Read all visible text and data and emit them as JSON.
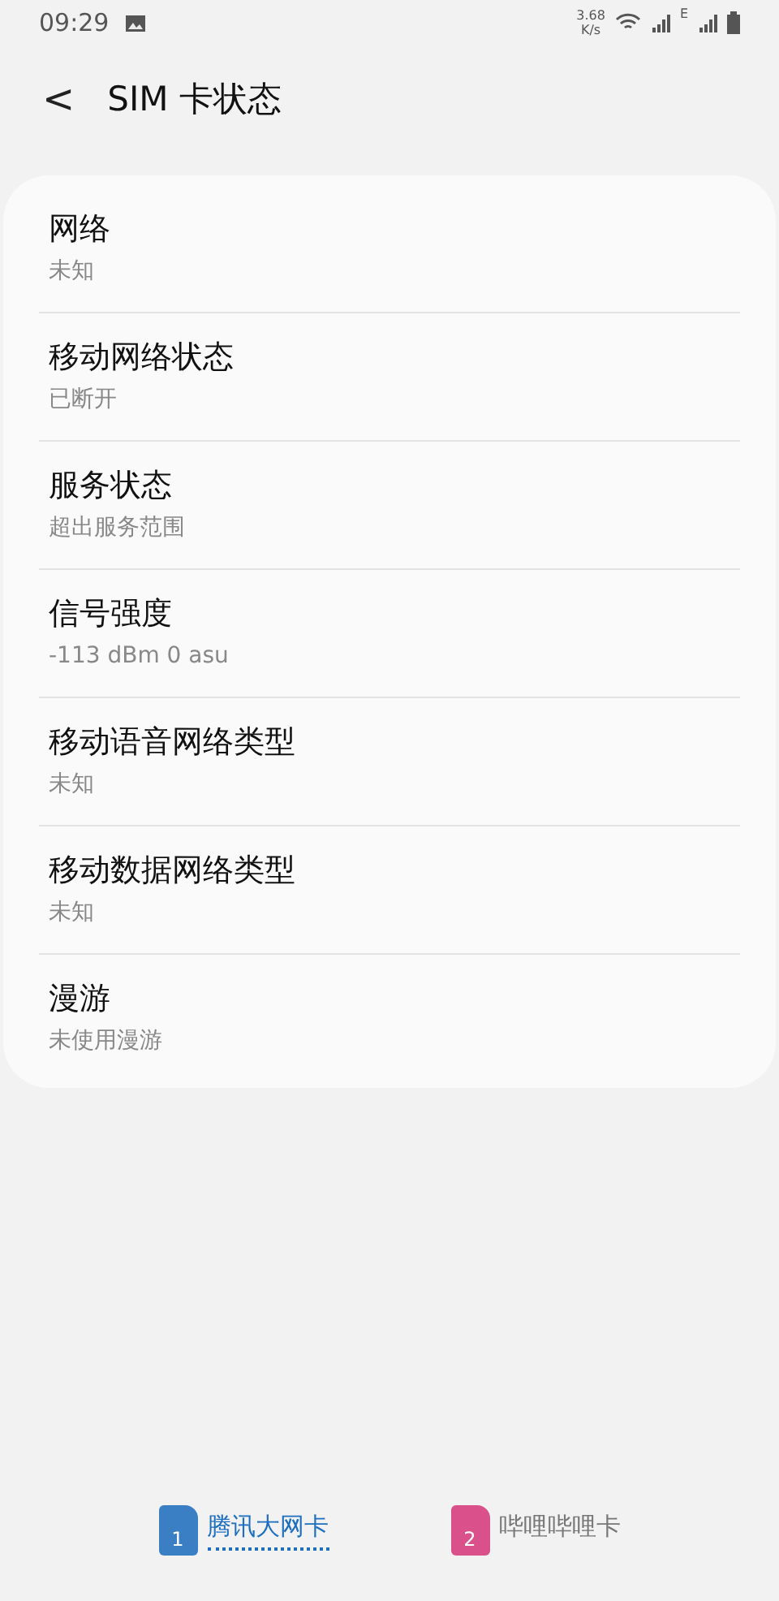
{
  "status_bar": {
    "time": "09:29",
    "speed_value": "3.68",
    "speed_unit": "K/s",
    "sim2_network": "E"
  },
  "header": {
    "back": "<",
    "title": "SIM 卡状态"
  },
  "items": [
    {
      "title": "网络",
      "value": "未知"
    },
    {
      "title": "移动网络状态",
      "value": "已断开"
    },
    {
      "title": "服务状态",
      "value": "超出服务范围"
    },
    {
      "title": "信号强度",
      "value": "-113 dBm 0 asu"
    },
    {
      "title": "移动语音网络类型",
      "value": "未知"
    },
    {
      "title": "移动数据网络类型",
      "value": "未知"
    },
    {
      "title": "漫游",
      "value": "未使用漫游"
    }
  ],
  "sim_tabs": [
    {
      "number": "1",
      "label": "腾讯大网卡",
      "selected": true,
      "color": "#3a7ec4"
    },
    {
      "number": "2",
      "label": "哔哩哔哩卡",
      "selected": false,
      "color": "#d9508a"
    }
  ]
}
